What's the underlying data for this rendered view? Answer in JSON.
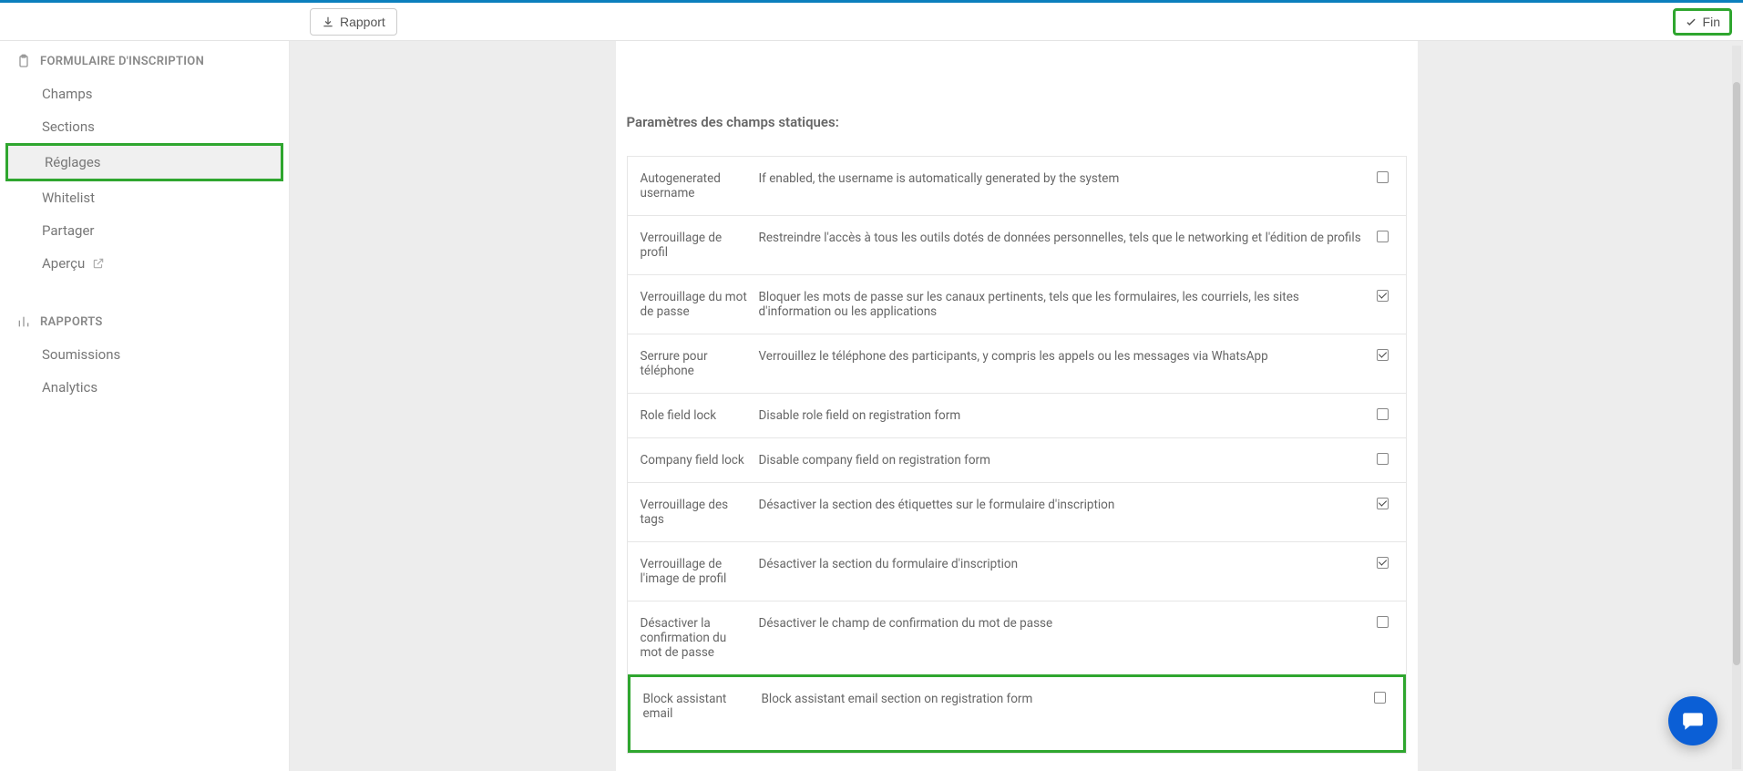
{
  "toolbar": {
    "report_label": "Rapport",
    "finish_label": "Fin"
  },
  "sidebar": {
    "form_section_title": "FORMULAIRE D'INSCRIPTION",
    "reports_section_title": "RAPPORTS",
    "items": [
      {
        "label": "Champs"
      },
      {
        "label": "Sections"
      },
      {
        "label": "Réglages"
      },
      {
        "label": "Whitelist"
      },
      {
        "label": "Partager"
      },
      {
        "label": "Aperçu"
      }
    ],
    "report_items": [
      {
        "label": "Soumissions"
      },
      {
        "label": "Analytics"
      }
    ]
  },
  "main": {
    "section_title": "Paramètres des champs statiques:",
    "rows": [
      {
        "label": "Autogenerated username",
        "desc": "If enabled, the username is automatically generated by the system",
        "checked": false
      },
      {
        "label": "Verrouillage de profil",
        "desc": "Restreindre l'accès à tous les outils dotés de données personnelles, tels que le networking et l'édition de profils",
        "checked": false
      },
      {
        "label": "Verrouillage du mot de passe",
        "desc": "Bloquer les mots de passe sur les canaux pertinents, tels que les formulaires, les courriels, les sites d'information ou les applications",
        "checked": true
      },
      {
        "label": "Serrure pour téléphone",
        "desc": "Verrouillez le téléphone des participants, y compris les appels ou les messages via WhatsApp",
        "checked": true
      },
      {
        "label": "Role field lock",
        "desc": "Disable role field on registration form",
        "checked": false
      },
      {
        "label": "Company field lock",
        "desc": "Disable company field on registration form",
        "checked": false
      },
      {
        "label": "Verrouillage des tags",
        "desc": "Désactiver la section des étiquettes sur le formulaire d'inscription",
        "checked": true
      },
      {
        "label": "Verrouillage de l'image de profil",
        "desc": "Désactiver la section du formulaire d'inscription",
        "checked": true
      },
      {
        "label": "Désactiver la confirmation du mot de passe",
        "desc": "Désactiver le champ de confirmation du mot de passe",
        "checked": false
      },
      {
        "label": "Block assistant email",
        "desc": "Block assistant email section on registration form",
        "checked": false
      }
    ]
  }
}
